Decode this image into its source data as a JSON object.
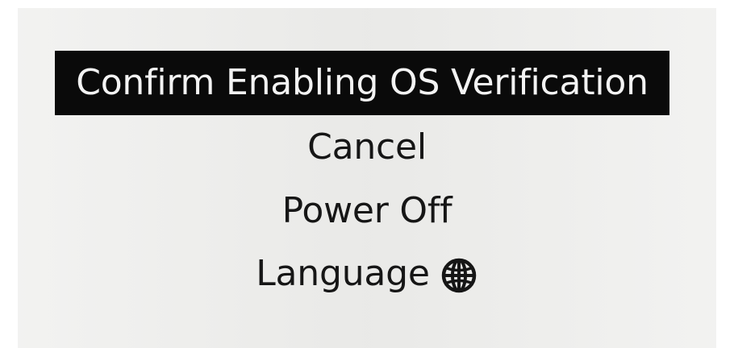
{
  "menu": {
    "items": [
      {
        "label": "Confirm Enabling OS Verification",
        "selected": true
      },
      {
        "label": "Cancel"
      },
      {
        "label": "Power Off"
      },
      {
        "label": "Language",
        "icon": "globe-icon"
      }
    ]
  },
  "colors": {
    "background": "#eeeeec",
    "text": "#161616",
    "selection_background": "#0a0a0a",
    "selection_text": "#f3f3f3"
  }
}
